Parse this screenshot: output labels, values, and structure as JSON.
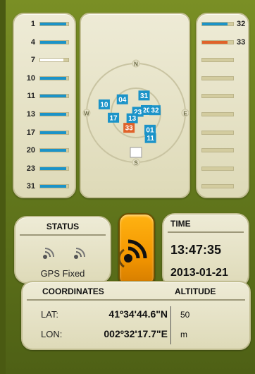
{
  "colors": {
    "signal_strong": "#1b93c8",
    "signal_weak": "#ffffff",
    "signal_alt": "#e0622a",
    "track": "#d3cc9f",
    "accent": "#f39600"
  },
  "snr_left": [
    {
      "prn": "1",
      "strength": 0.92,
      "color": "signal_strong"
    },
    {
      "prn": "4",
      "strength": 0.92,
      "color": "signal_strong"
    },
    {
      "prn": "7",
      "strength": 0.82,
      "color": "signal_weak"
    },
    {
      "prn": "10",
      "strength": 0.92,
      "color": "signal_strong"
    },
    {
      "prn": "11",
      "strength": 0.92,
      "color": "signal_strong"
    },
    {
      "prn": "13",
      "strength": 0.92,
      "color": "signal_strong"
    },
    {
      "prn": "17",
      "strength": 0.92,
      "color": "signal_strong"
    },
    {
      "prn": "20",
      "strength": 0.92,
      "color": "signal_strong"
    },
    {
      "prn": "23",
      "strength": 0.92,
      "color": "signal_strong"
    },
    {
      "prn": "31",
      "strength": 0.92,
      "color": "signal_strong"
    }
  ],
  "snr_right": [
    {
      "prn": "32",
      "strength": 0.82,
      "color": "signal_strong"
    },
    {
      "prn": "33",
      "strength": 0.82,
      "color": "signal_alt"
    },
    {
      "prn": "",
      "strength": 0,
      "color": "track"
    },
    {
      "prn": "",
      "strength": 0,
      "color": "track"
    },
    {
      "prn": "",
      "strength": 0,
      "color": "track"
    },
    {
      "prn": "",
      "strength": 0,
      "color": "track"
    },
    {
      "prn": "",
      "strength": 0,
      "color": "track"
    },
    {
      "prn": "",
      "strength": 0,
      "color": "track"
    },
    {
      "prn": "",
      "strength": 0,
      "color": "track"
    },
    {
      "prn": "",
      "strength": 0,
      "color": "track"
    }
  ],
  "sky": {
    "compass": {
      "n": "N",
      "e": "E",
      "s": "S",
      "w": "W"
    },
    "satellites": [
      {
        "prn": "31",
        "az": 25,
        "el": 55,
        "color": "signal_strong"
      },
      {
        "prn": "04",
        "az": 315,
        "el": 55,
        "color": "signal_strong"
      },
      {
        "prn": "20",
        "az": 75,
        "el": 70,
        "color": "signal_strong"
      },
      {
        "prn": "32",
        "az": 82,
        "el": 55,
        "color": "signal_strong"
      },
      {
        "prn": "10",
        "az": 285,
        "el": 30,
        "color": "signal_strong"
      },
      {
        "prn": "23",
        "az": 60,
        "el": 86,
        "color": "signal_strong"
      },
      {
        "prn": "17",
        "az": 258,
        "el": 48,
        "color": "signal_strong"
      },
      {
        "prn": "13",
        "az": 215,
        "el": 78,
        "color": "signal_strong"
      },
      {
        "prn": "33",
        "az": 205,
        "el": 60,
        "color": "signal_alt"
      },
      {
        "prn": "01",
        "az": 140,
        "el": 50,
        "color": "signal_strong"
      },
      {
        "prn": "11",
        "az": 150,
        "el": 37,
        "color": "signal_strong"
      },
      {
        "prn": "07",
        "az": 180,
        "el": 18,
        "color": "signal_weak"
      }
    ]
  },
  "status": {
    "title": "STATUS",
    "text": "GPS Fixed"
  },
  "gps_button": {
    "icon": "gps-signal-icon"
  },
  "time": {
    "title": "TIME",
    "time": "13:47:35",
    "date": "2013-01-21"
  },
  "coordinates": {
    "title": "COORDINATES",
    "lat_label": "LAT:",
    "lat": "41º34'44.6\"N",
    "lon_label": "LON:",
    "lon": "002º32'17.7\"E"
  },
  "altitude": {
    "title": "ALTITUDE",
    "value": "50",
    "unit": "m"
  }
}
